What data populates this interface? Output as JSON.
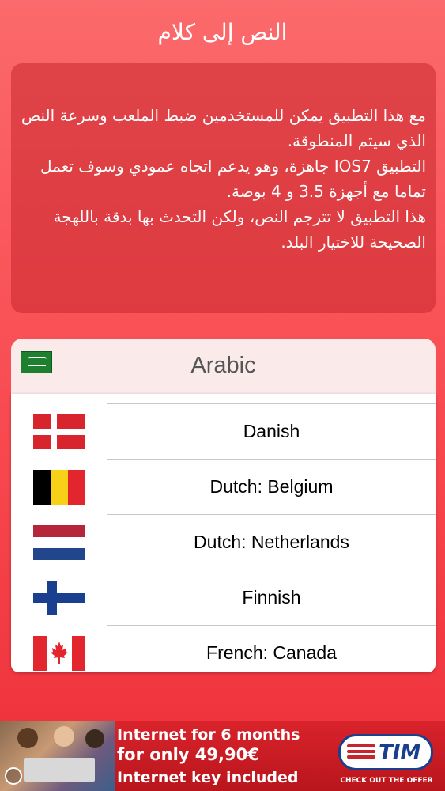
{
  "header": {
    "title": "النص إلى كلام"
  },
  "description": {
    "lines": [
      "مع هذا التطبيق يمكن للمستخدمين ضبط الملعب وسرعة النص الذي سيتم المنطوقة.",
      "التطبيق IOS7 جاهزة، وهو يدعم اتجاه عمودي وسوف تعمل تماما مع أجهزة 3.5 و 4 بوصة.",
      "هذا التطبيق لا تترجم النص، ولكن التحدث بها بدقة باللهجة الصحيحة للاختيار البلد."
    ]
  },
  "selected_language": {
    "label": "Arabic",
    "flag_icon": "saudi-arabia-flag-icon"
  },
  "language_list": {
    "items": [
      {
        "label": "Danish",
        "flag_icon": "denmark-flag-icon"
      },
      {
        "label": "Dutch: Belgium",
        "flag_icon": "belgium-flag-icon"
      },
      {
        "label": "Dutch: Netherlands",
        "flag_icon": "netherlands-flag-icon"
      },
      {
        "label": "Finnish",
        "flag_icon": "finland-flag-icon"
      },
      {
        "label": "French: Canada",
        "flag_icon": "canada-flag-icon"
      }
    ]
  },
  "ad_banner": {
    "line1": "Internet for 6 months",
    "line2": "for only 49,90€",
    "line3": "Internet key included",
    "brand": "TIM",
    "cta": "CHECK OUT THE OFFER"
  },
  "colors": {
    "background_top": "#fb6a6c",
    "background_bottom": "#ee2f3a",
    "ad_red": "#d9232b",
    "tim_blue": "#1b3f8f"
  }
}
